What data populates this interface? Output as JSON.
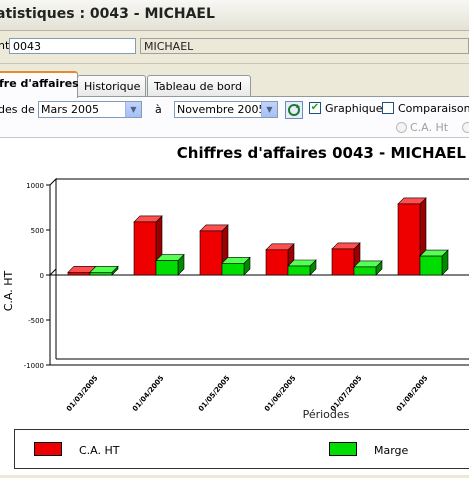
{
  "window": {
    "title": "atistiques : 0043 - MICHAEL"
  },
  "client": {
    "label": "nt",
    "code": "0043",
    "name": "MICHAEL"
  },
  "tabs": [
    {
      "label": "fre d'affaires",
      "active": true
    },
    {
      "label": "Historique",
      "active": false
    },
    {
      "label": "Tableau de bord",
      "active": false
    }
  ],
  "filters": {
    "from_label": "des de",
    "from_value": "Mars 2005",
    "to_label": "à",
    "to_value": "Novembre 2005",
    "graphique_label": "Graphique",
    "graphique_checked": true,
    "comparaison_label": "Comparaison p",
    "comparaison_checked": false,
    "radio_label": "C.A. Ht"
  },
  "colors": {
    "ca": "#ee0000",
    "marge": "#00dd00"
  },
  "chart_data": {
    "type": "bar",
    "title": "Chiffres d'affaires 0043 - MICHAEL",
    "xlabel": "Périodes",
    "ylabel": "C.A. HT",
    "ylim": [
      -1000,
      1000
    ],
    "yticks": [
      "1000",
      "500",
      "0",
      "-500",
      "-1000"
    ],
    "categories": [
      "01/03/2005",
      "01/04/2005",
      "01/05/2005",
      "01/06/2005",
      "01/07/2005",
      "01/08/2005"
    ],
    "series": [
      {
        "name": "C.A. HT",
        "values": [
          30,
          590,
          490,
          280,
          290,
          790
        ]
      },
      {
        "name": "Marge",
        "values": [
          30,
          160,
          130,
          100,
          90,
          210
        ]
      }
    ]
  },
  "legend": {
    "ca_label": "C.A. HT",
    "marge_label": "Marge"
  }
}
